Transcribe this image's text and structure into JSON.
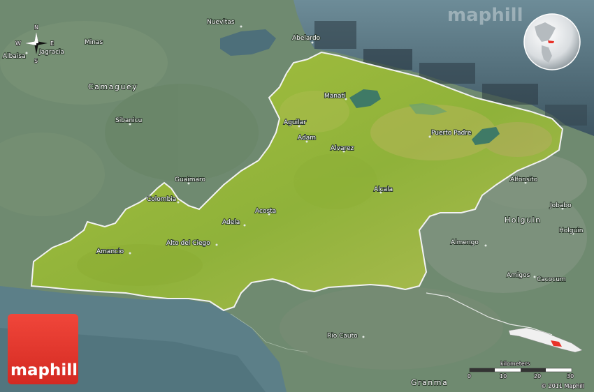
{
  "watermark": "maphill",
  "logo": {
    "text": "maphill",
    "color": "#e8332a"
  },
  "compass": {
    "n": "N",
    "s": "S",
    "e": "E",
    "w": "W"
  },
  "scale": {
    "title": "kilometers",
    "ticks": [
      "0",
      "10",
      "20",
      "30"
    ]
  },
  "copyright": "© 2011 Maphill",
  "colors": {
    "sea": "#5a7f8c",
    "deep_sea": "#3a5663",
    "land": "#6e8c6a",
    "province": "#9bb83a",
    "border": "#f2f2f2"
  },
  "regions": [
    "Camaguey",
    "Holguin",
    "Granma"
  ],
  "places": [
    "Nuevitas",
    "Minas",
    "Albaisa",
    "Jagracia",
    "Abelardo",
    "Manati",
    "Sibanicu",
    "Aguilar",
    "Adam",
    "Alvarez",
    "Puerto Padre",
    "Guaimaro",
    "Colombia",
    "Alcala",
    "Alfonsito",
    "Jobabo",
    "Holguin",
    "Acosta",
    "Adela",
    "Alto del Ciego",
    "Amancio",
    "Almengo",
    "Amigos",
    "Cacocum",
    "Rio Cauto"
  ]
}
